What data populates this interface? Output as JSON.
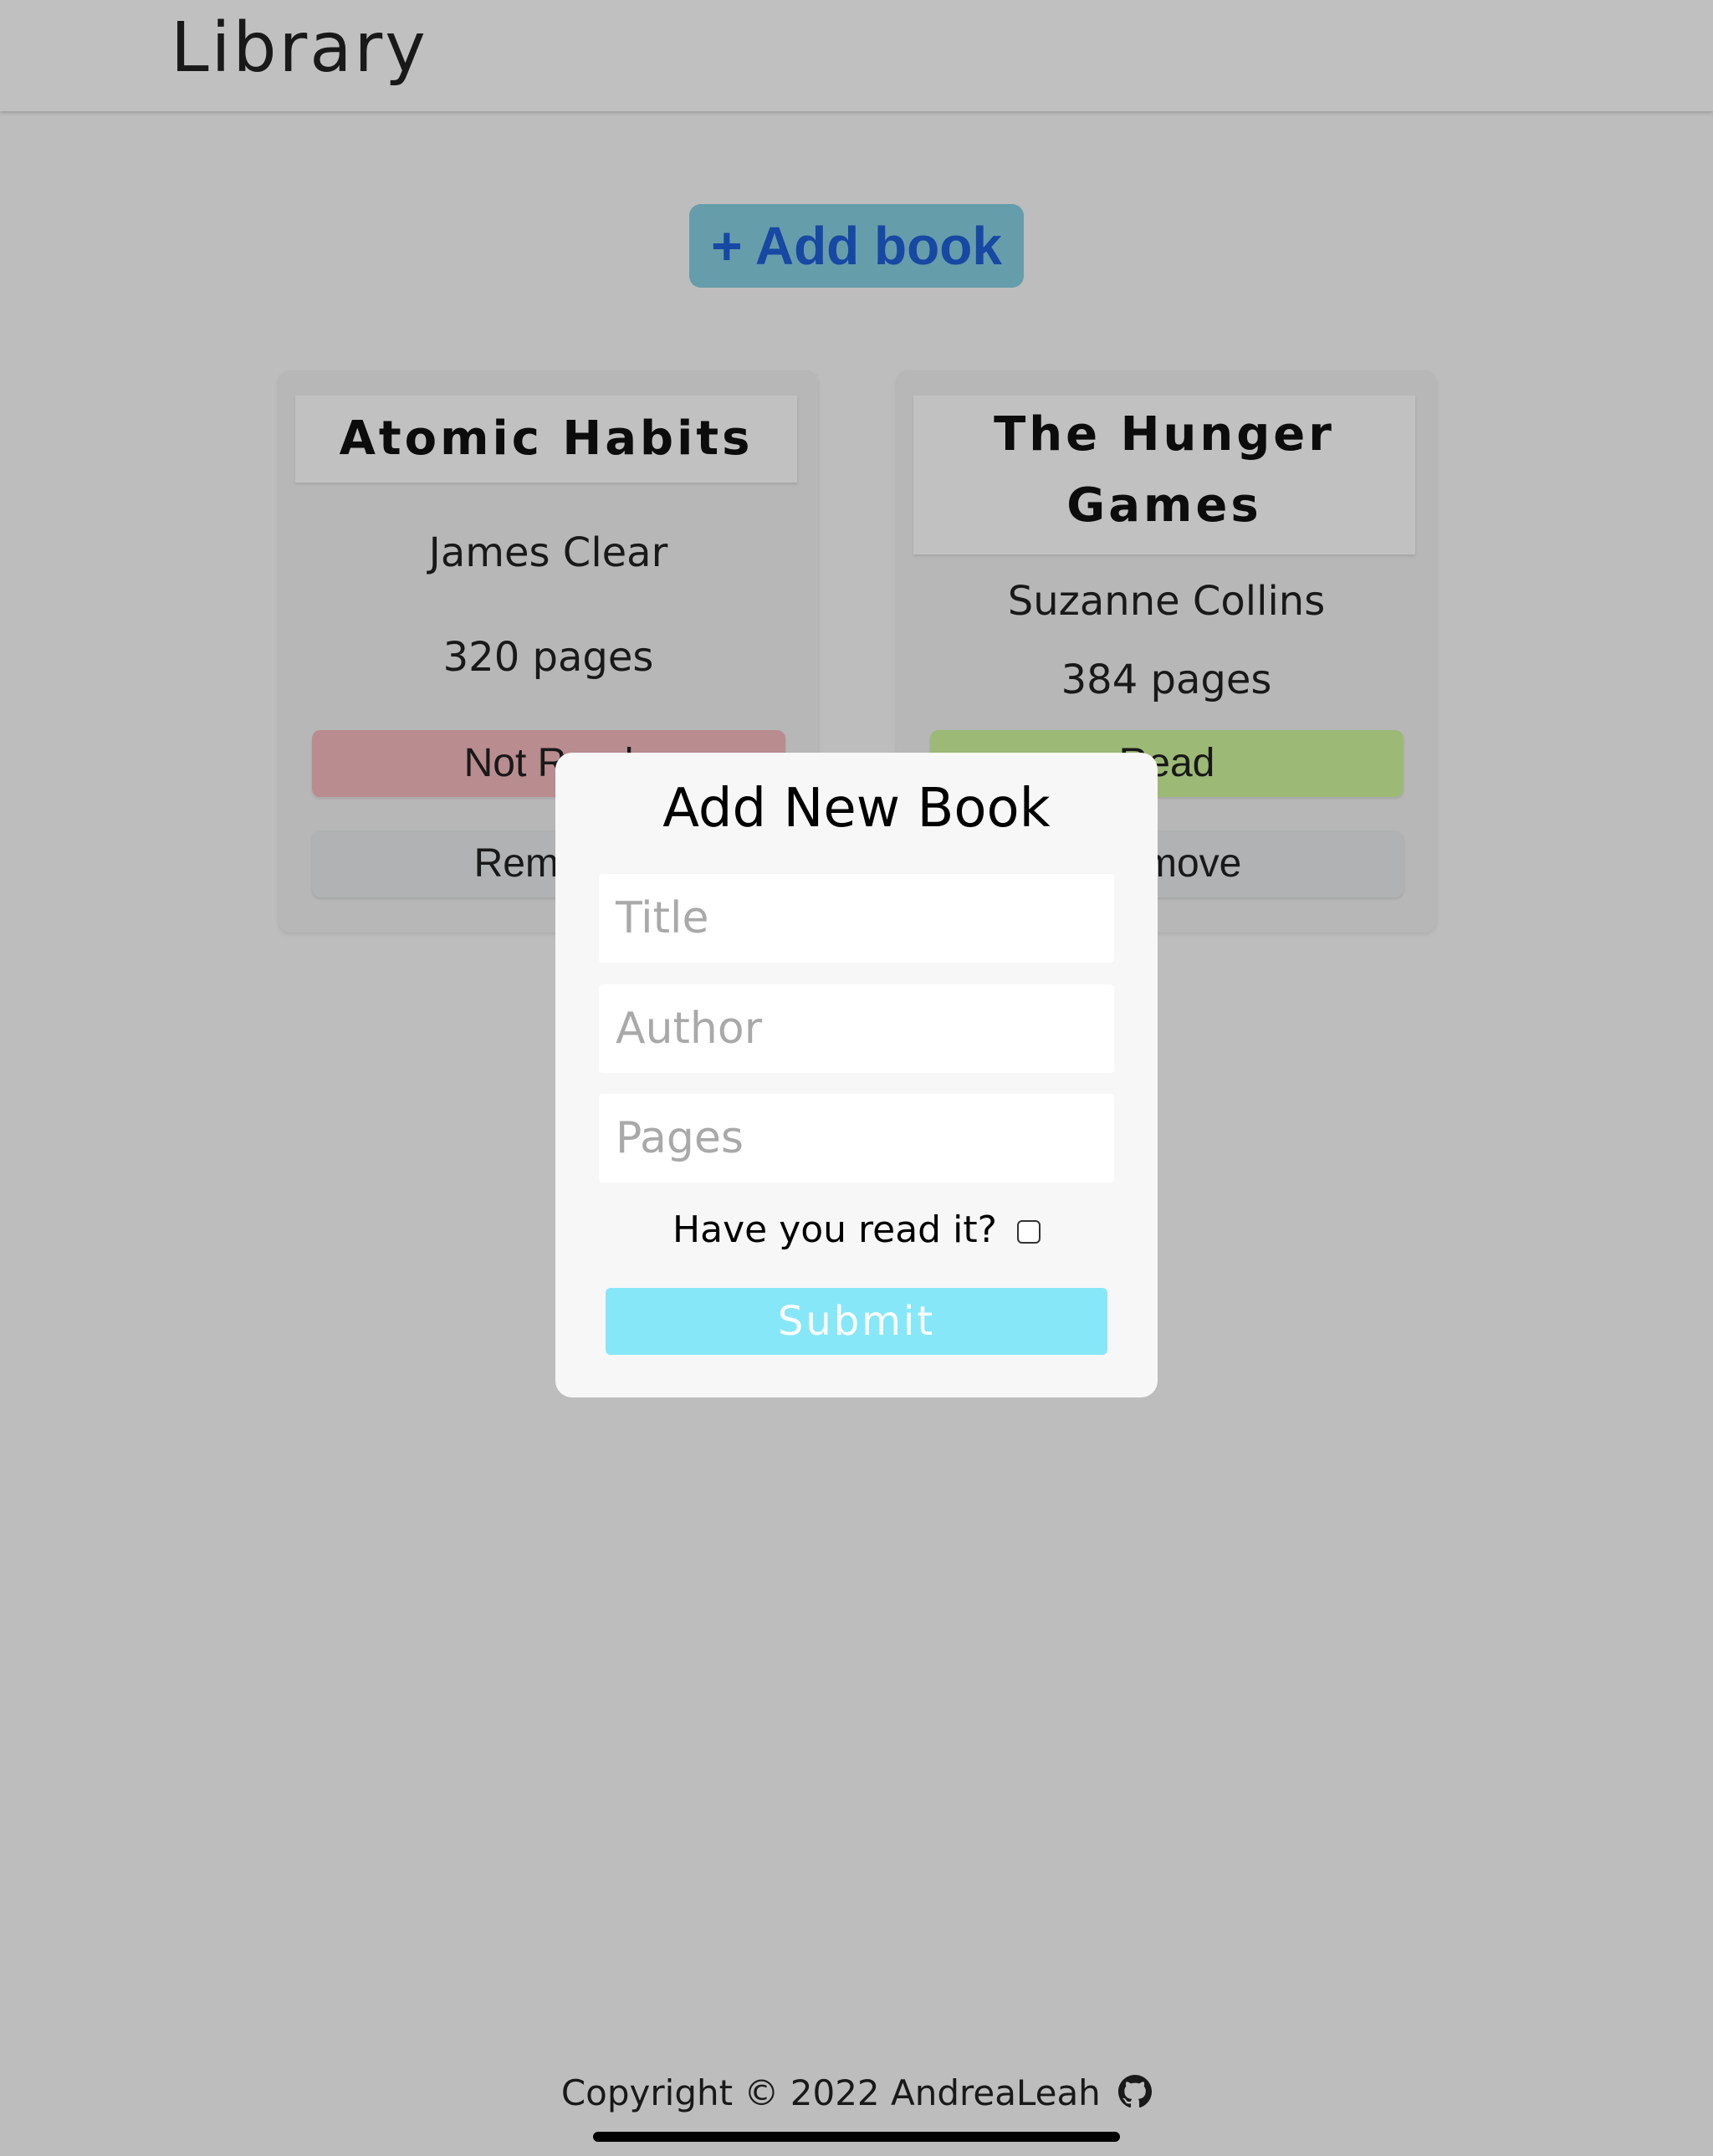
{
  "header": {
    "title": "Library"
  },
  "toolbar": {
    "add_book_label": "+ Add book"
  },
  "books": [
    {
      "title": "Atomic Habits",
      "author": "James Clear",
      "pages": "320 pages",
      "status": "Not Read",
      "remove_label": "Remove"
    },
    {
      "title": "The Hunger Games",
      "author": "Suzanne Collins",
      "pages": "384 pages",
      "status": "Read",
      "remove_label": "Remove"
    }
  ],
  "modal": {
    "title": "Add New Book",
    "title_placeholder": "Title",
    "author_placeholder": "Author",
    "pages_placeholder": "Pages",
    "read_label": "Have you read it?",
    "submit_label": "Submit"
  },
  "footer": {
    "copyright": "Copyright © 2022 AndreaLeah",
    "icon": "github-icon"
  },
  "colors": {
    "not_read": "#f3b9bc",
    "read": "#cdf39c",
    "submit": "#86e7f9",
    "add_button": "#87cfe0"
  }
}
